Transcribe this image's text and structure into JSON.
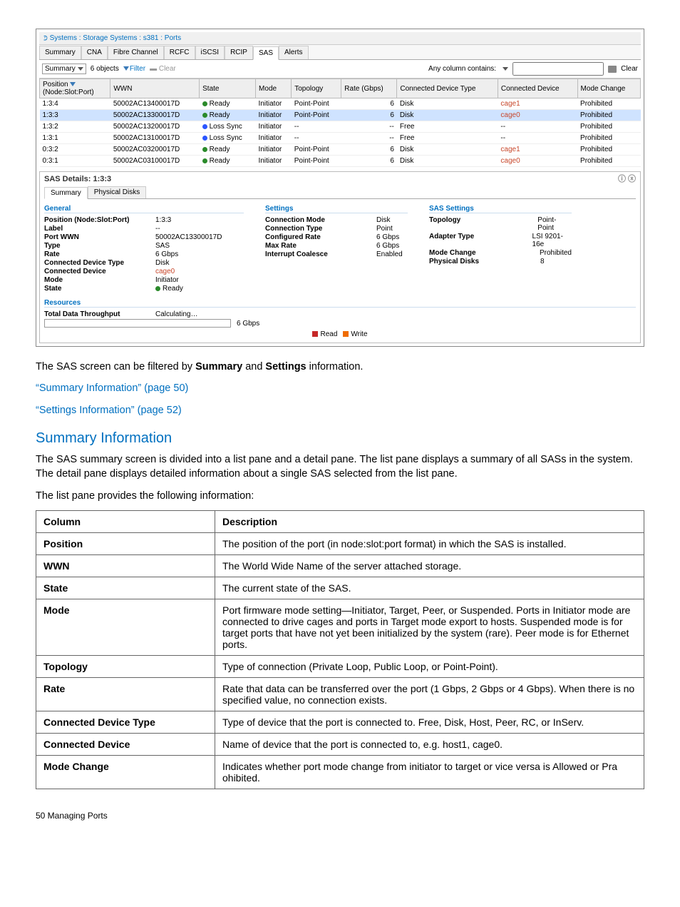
{
  "app": {
    "breadcrumb": "Systems : Storage Systems : s381 : Ports",
    "outer_tabs": [
      "Summary",
      "CNA",
      "Fibre Channel",
      "RCFC",
      "iSCSI",
      "RCIP",
      "SAS",
      "Alerts"
    ],
    "outer_tab_active": 6,
    "toolbar": {
      "view_label": "Summary",
      "count": "6 objects",
      "filter": "Filter",
      "clear": "Clear",
      "any_col": "Any column contains:",
      "clear_right": "Clear"
    },
    "columns": [
      "Position (Node:Slot:Port)",
      "WWN",
      "State",
      "Mode",
      "Topology",
      "Rate (Gbps)",
      "Connected Device Type",
      "Connected Device",
      "Mode Change"
    ],
    "rows": [
      {
        "pos": "1:3:4",
        "wwn": "50002AC13400017D",
        "state": "Ready",
        "state_cls": "green",
        "mode": "Initiator",
        "topo": "Point-Point",
        "rate": "6",
        "cdt": "Disk",
        "cd": "cage1",
        "mc": "Prohibited",
        "sel": false
      },
      {
        "pos": "1:3:3",
        "wwn": "50002AC13300017D",
        "state": "Ready",
        "state_cls": "green",
        "mode": "Initiator",
        "topo": "Point-Point",
        "rate": "6",
        "cdt": "Disk",
        "cd": "cage0",
        "mc": "Prohibited",
        "sel": true
      },
      {
        "pos": "1:3:2",
        "wwn": "50002AC13200017D",
        "state": "Loss Sync",
        "state_cls": "blue",
        "mode": "Initiator",
        "topo": "--",
        "rate": "--",
        "cdt": "Free",
        "cd": "--",
        "mc": "Prohibited",
        "sel": false
      },
      {
        "pos": "1:3:1",
        "wwn": "50002AC13100017D",
        "state": "Loss Sync",
        "state_cls": "blue",
        "mode": "Initiator",
        "topo": "--",
        "rate": "--",
        "cdt": "Free",
        "cd": "--",
        "mc": "Prohibited",
        "sel": false
      },
      {
        "pos": "0:3:2",
        "wwn": "50002AC03200017D",
        "state": "Ready",
        "state_cls": "green",
        "mode": "Initiator",
        "topo": "Point-Point",
        "rate": "6",
        "cdt": "Disk",
        "cd": "cage1",
        "mc": "Prohibited",
        "sel": false
      },
      {
        "pos": "0:3:1",
        "wwn": "50002AC03100017D",
        "state": "Ready",
        "state_cls": "green",
        "mode": "Initiator",
        "topo": "Point-Point",
        "rate": "6",
        "cdt": "Disk",
        "cd": "cage0",
        "mc": "Prohibited",
        "sel": false
      }
    ],
    "details": {
      "title": "SAS Details: 1:3:3",
      "inner_tabs": [
        "Summary",
        "Physical Disks"
      ],
      "inner_active": 0,
      "general_title": "General",
      "general": [
        {
          "k": "Position (Node:Slot:Port)",
          "v": "1:3:3"
        },
        {
          "k": "Label",
          "v": "--"
        },
        {
          "k": "Port WWN",
          "v": "50002AC13300017D"
        },
        {
          "k": "Type",
          "v": "SAS"
        },
        {
          "k": "Rate",
          "v": "6 Gbps"
        },
        {
          "k": "Connected Device Type",
          "v": "Disk"
        },
        {
          "k": "Connected Device",
          "v": "cage0",
          "link": true
        },
        {
          "k": "Mode",
          "v": "Initiator"
        },
        {
          "k": "State",
          "v": "Ready",
          "dot": "green"
        }
      ],
      "settings_title": "Settings",
      "settings": [
        {
          "k": "Connection Mode",
          "v": "Disk"
        },
        {
          "k": "Connection Type",
          "v": "Point"
        },
        {
          "k": "Configured Rate",
          "v": "6 Gbps"
        },
        {
          "k": "Max Rate",
          "v": "6 Gbps"
        },
        {
          "k": "Interrupt Coalesce",
          "v": "Enabled"
        }
      ],
      "sas_title": "SAS Settings",
      "sas": [
        {
          "k": "Topology",
          "v": "Point-Point"
        },
        {
          "k": "Adapter Type",
          "v": "LSI 9201-16e"
        },
        {
          "k": "Mode Change",
          "v": "Prohibited"
        },
        {
          "k": "Physical Disks",
          "v": "8"
        }
      ],
      "resources_title": "Resources",
      "throughput_label": "Total Data Throughput",
      "throughput_value": "Calculating…",
      "throughput_rate": "6 Gbps",
      "legend_read": "Read",
      "legend_write": "Write"
    }
  },
  "doc": {
    "p1a": "The SAS screen can be filtered by ",
    "p1b": "Summary",
    "p1c": " and ",
    "p1d": "Settings",
    "p1e": " information.",
    "link1": "“Summary Information” (page 50)",
    "link2": "“Settings Information” (page 52)",
    "section": "Summary Information",
    "p2": "The SAS summary screen is divided into a list pane and a detail pane. The list pane displays a summary of all SASs in the system. The detail pane displays detailed information about a single SAS selected from the list pane.",
    "p3": "The list pane provides the following information:",
    "th1": "Column",
    "th2": "Description",
    "rows": [
      {
        "c": "Position",
        "d": "The position of the port (in node:slot:port format) in which the SAS is installed."
      },
      {
        "c": "WWN",
        "d": "The World Wide Name of the server attached storage."
      },
      {
        "c": "State",
        "d": "The current state of the SAS."
      },
      {
        "c": "Mode",
        "d": "Port firmware mode setting—Initiator, Target, Peer, or Suspended. Ports in Initiator mode are connected to drive cages and ports in Target mode export to hosts. Suspended mode is for target ports that have not yet been initialized by the system (rare). Peer mode is for Ethernet ports."
      },
      {
        "c": "Topology",
        "d": "Type of connection (Private Loop, Public Loop, or Point-Point)."
      },
      {
        "c": "Rate",
        "d": "Rate that data can be transferred over the port (1 Gbps, 2 Gbps or 4 Gbps). When there is no specified value, no connection exists."
      },
      {
        "c": "Connected Device Type",
        "d": "Type of device that the port is connected to. Free, Disk, Host, Peer, RC, or InServ."
      },
      {
        "c": "Connected Device",
        "d": "Name of device that the port is connected to, e.g. host1, cage0."
      },
      {
        "c": "Mode Change",
        "d": "Indicates whether port mode change from initiator to target or vice versa is Allowed or Pra ohibited."
      }
    ],
    "footer": "50    Managing Ports"
  }
}
